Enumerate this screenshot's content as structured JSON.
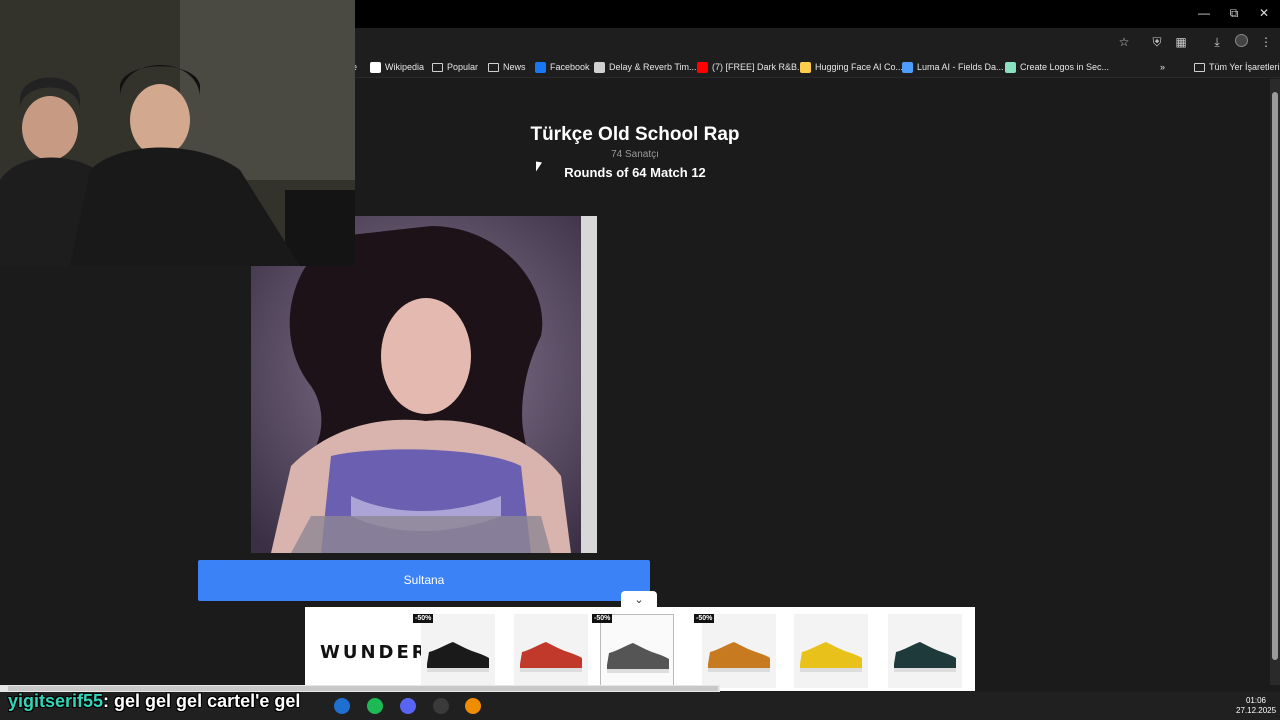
{
  "browser": {
    "bookmarks": [
      {
        "label": "e",
        "kind": "partial"
      },
      {
        "label": "Wikipedia",
        "kind": "site",
        "color": "#ffffff"
      },
      {
        "label": "Popular",
        "kind": "folder"
      },
      {
        "label": "News",
        "kind": "folder"
      },
      {
        "label": "Facebook",
        "kind": "site",
        "color": "#1877f2"
      },
      {
        "label": "Delay & Reverb Tim...",
        "kind": "site",
        "color": "#d0d0d0"
      },
      {
        "label": "(7) [FREE] Dark R&B...",
        "kind": "site",
        "color": "#ff0000"
      },
      {
        "label": "Hugging Face AI Co...",
        "kind": "site",
        "color": "#ffcc4d"
      },
      {
        "label": "Luma AI - Fields Da...",
        "kind": "site",
        "color": "#4f9cf9"
      },
      {
        "label": "Create Logos in Sec...",
        "kind": "site",
        "color": "#8be0c0"
      }
    ],
    "more_bookmarks": "»",
    "all_bookmarks": "Tüm Yer İşaretleri",
    "icons": [
      "star-icon",
      "shield-icon",
      "extensions-icon",
      "download-icon",
      "profile-icon",
      "menu-icon"
    ],
    "window_controls": [
      "minimize-icon",
      "restore-icon",
      "close-icon"
    ]
  },
  "page": {
    "title": "Türkçe Old School Rap",
    "subtitle": "74 Sanatçı",
    "round": "Rounds of 64 Match 12",
    "choice_label": "Sultana",
    "choice_color": "#3b82f6"
  },
  "ad": {
    "brand": "WUNDER",
    "toggle_icon": "chevron-down-icon",
    "products": [
      {
        "badge": "-50%",
        "color": "#1a1a1a",
        "selected": false
      },
      {
        "badge": "",
        "color": "#c0392b",
        "selected": false
      },
      {
        "badge": "-50%",
        "color": "#555555",
        "selected": true
      },
      {
        "badge": "-50%",
        "color": "#c77a1f",
        "selected": false
      },
      {
        "badge": "",
        "color": "#e8c21a",
        "selected": false
      },
      {
        "badge": "",
        "color": "#1f3a3a",
        "selected": false
      }
    ]
  },
  "stream": {
    "chat_user": "yigitserif55",
    "chat_message": ": gel gel gel cartel'e gel"
  },
  "taskbar": {
    "apps": [
      {
        "name": "outlook-icon",
        "color": "#1f6fd1"
      },
      {
        "name": "spotify-icon",
        "color": "#1db954"
      },
      {
        "name": "discord-icon",
        "color": "#5865f2"
      },
      {
        "name": "obs-icon",
        "color": "#3a3a3a"
      },
      {
        "name": "vlc-icon",
        "color": "#f08c00"
      }
    ],
    "time": "01:06",
    "date": "27.12.2025"
  }
}
